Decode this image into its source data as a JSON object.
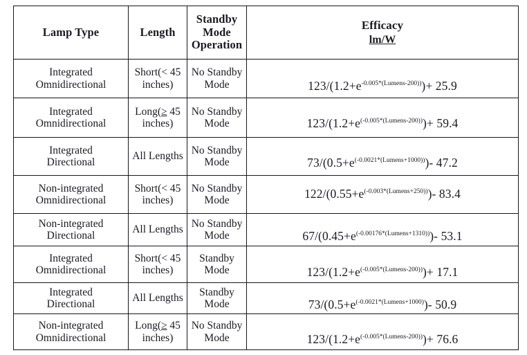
{
  "table": {
    "headers": [
      {
        "id": "lamp-type",
        "label": "Lamp Type"
      },
      {
        "id": "length",
        "label": "Length"
      },
      {
        "id": "standby-mode-operation",
        "label": "Standby Mode Operation"
      },
      {
        "id": "efficacy",
        "label": "Efficacy",
        "sub": "lm/W"
      }
    ],
    "header_lines": {
      "standby": [
        "Standby",
        "Mode",
        "Operation"
      ]
    },
    "rows": [
      {
        "lamp_type": [
          "Integrated",
          "Omnidirectional"
        ],
        "length": [
          "Short(< 45",
          "inches)"
        ],
        "length_ge": false,
        "standby": [
          "No Standby",
          "Mode"
        ],
        "efficacy": {
          "text": "123/(1.2+e^-0.005*(Lumens-200)) + 25.9",
          "lead": "123/(1.2+e",
          "exponent": "-0.005*(Lumens-200))",
          "tail": ")+ 25.9",
          "numerator": 123,
          "denom_const": 1.2,
          "rate": -0.005,
          "offset": -200,
          "constant": 25.9
        }
      },
      {
        "lamp_type": [
          "Integrated",
          "Omnidirectional"
        ],
        "length": [
          "Long(≥ 45",
          "inches)"
        ],
        "length_ge": true,
        "standby": [
          "No Standby",
          "Mode"
        ],
        "efficacy": {
          "text": "123/(1.2+e^(-0.005*(Lumens-200))) + 59.4",
          "lead": "123/(1.2+e",
          "exponent": "(-0.005*(Lumens-200))",
          "tail": ")+ 59.4",
          "numerator": 123,
          "denom_const": 1.2,
          "rate": -0.005,
          "offset": -200,
          "constant": 59.4
        }
      },
      {
        "lamp_type": [
          "Integrated",
          "Directional"
        ],
        "length": [
          "All Lengths"
        ],
        "length_ge": false,
        "standby": [
          "No Standby",
          "Mode"
        ],
        "efficacy": {
          "text": "73/(0.5+e^(-0.0021*(Lumens+1000))) - 47.2",
          "lead": "73/(0.5+e",
          "exponent": "(-0.0021*(Lumens+1000))",
          "tail": ")- 47.2",
          "numerator": 73,
          "denom_const": 0.5,
          "rate": -0.0021,
          "offset": 1000,
          "constant": -47.2
        }
      },
      {
        "lamp_type": [
          "Non-integrated",
          "Omnidirectional"
        ],
        "length": [
          "Short(< 45",
          "inches)"
        ],
        "length_ge": false,
        "standby": [
          "No Standby",
          "Mode"
        ],
        "efficacy": {
          "text": "122/(0.55+e^(-0.003*(Lumens+250))) - 83.4",
          "lead": "122/(0.55+e",
          "exponent": "(-0.003*(Lumens+250))",
          "tail": ")- 83.4",
          "numerator": 122,
          "denom_const": 0.55,
          "rate": -0.003,
          "offset": 250,
          "constant": -83.4
        }
      },
      {
        "lamp_type": [
          "Non-integrated",
          "Directional"
        ],
        "length": [
          "All Lengths"
        ],
        "length_ge": false,
        "standby": [
          "No Standby",
          "Mode"
        ],
        "efficacy": {
          "text": "67/(0.45+e^(-0.00176*(Lumens+1310))) - 53.1",
          "lead": "67/(0.45+e",
          "exponent": "(-0.00176*(Lumens+1310))",
          "tail": ")- 53.1",
          "numerator": 67,
          "denom_const": 0.45,
          "rate": -0.00176,
          "offset": 1310,
          "constant": -53.1
        }
      },
      {
        "lamp_type": [
          "Integrated",
          "Omnidirectional"
        ],
        "length": [
          "Short(< 45",
          "inches)"
        ],
        "length_ge": false,
        "standby": [
          "Standby",
          "Mode"
        ],
        "efficacy": {
          "text": "123/(1.2+e^(-0.005*(Lumens-200))) + 17.1",
          "lead": "123/(1.2+e",
          "exponent": "(-0.005*(Lumens-200))",
          "tail": ")+ 17.1",
          "numerator": 123,
          "denom_const": 1.2,
          "rate": -0.005,
          "offset": -200,
          "constant": 17.1
        }
      },
      {
        "lamp_type": [
          "Integrated",
          "Directional"
        ],
        "length": [
          "All Lengths"
        ],
        "length_ge": false,
        "standby": [
          "Standby",
          "Mode"
        ],
        "efficacy": {
          "text": "73/(0.5+e^(-0.0021*(Lumens+1000)) - 50.9",
          "lead": "73/(0.5+e",
          "exponent": "(-0.0021*(Lumens+1000)",
          "tail": ")- 50.9",
          "numerator": 73,
          "denom_const": 0.5,
          "rate": -0.0021,
          "offset": 1000,
          "constant": -50.9
        }
      },
      {
        "lamp_type": [
          "Non-integrated",
          "Omnidirectional"
        ],
        "length": [
          "Long(≥ 45",
          "inches)"
        ],
        "length_ge": true,
        "standby": [
          "No Standby",
          "Mode"
        ],
        "efficacy": {
          "text": "123/(1.2+e^(-0.005*(Lumens-200))) + 76.6",
          "lead": "123/(1.2+e",
          "exponent": "(-0.005*(Lumens-200))",
          "tail": ")+ 76.6",
          "numerator": 123,
          "denom_const": 1.2,
          "rate": -0.005,
          "offset": -200,
          "constant": 76.6
        }
      }
    ]
  },
  "style": {
    "border_color": "#15151c",
    "text_color": "#1a1a22",
    "background": "#ffffff"
  }
}
